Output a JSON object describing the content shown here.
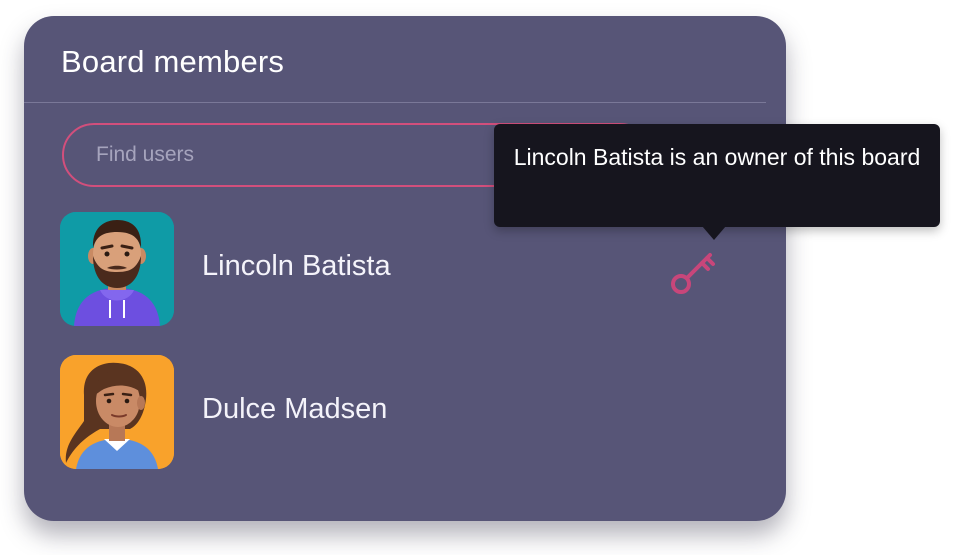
{
  "panel": {
    "title": "Board members"
  },
  "search": {
    "placeholder": "Find users",
    "value": ""
  },
  "members": [
    {
      "name": "Lincoln Batista",
      "avatar_bg": "#0f9ba6",
      "is_owner": true
    },
    {
      "name": "Dulce Madsen",
      "avatar_bg": "#f9a22b",
      "is_owner": false
    }
  ],
  "owner_icon": "key-icon",
  "tooltip": {
    "text": "Lincoln Batista is an owner of this board"
  },
  "colors": {
    "panel_bg": "#575577",
    "accent": "#d24f7c",
    "tooltip_bg": "#16151e"
  }
}
